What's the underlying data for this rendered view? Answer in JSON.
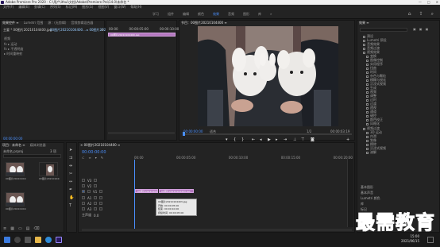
{
  "window": {
    "title": "Adobe Premiere Pro 2020 - C:\\用户\\ithui\\文档\\Adobe\\Premiere Pro\\14.0\\未命名 *",
    "controls": [
      "—",
      "□",
      "✕"
    ]
  },
  "menu": [
    "文件(F)",
    "编辑(E)",
    "剪辑(C)",
    "序列(S)",
    "标记(M)",
    "图形(G)",
    "视图(V)",
    "窗口(W)",
    "帮助(H)"
  ],
  "workspace": {
    "tabs": [
      "学习",
      "组件",
      "编辑",
      "颜色",
      "效果",
      "音频",
      "图形",
      "库"
    ],
    "active": "效果",
    "more": "»"
  },
  "source_panel": {
    "tabs": [
      "效果控件 ≡",
      "Lumetri 范围",
      "源：(无剪辑)",
      "音频剪辑混合器"
    ],
    "header": "主要 * 00图片20210104400.jpg",
    "seq_label": "00图片20210104400... ▸ 00图片20210104400.jpg",
    "rows": [
      "视频",
      "fx ▸ 运动",
      "fx ▸ 不透明度",
      "▸ 时间重映射"
    ],
    "timecode": "00:00:00:00"
  },
  "ec_timeline": {
    "ticks": [
      "00:00",
      "00:00:05:00",
      "00:00:10:00"
    ],
    "clip": "00图片20210104400.jpg"
  },
  "program": {
    "title": "节目：00图片20210104400 ≡",
    "timecode": "00:00:00:00",
    "fit": "适合",
    "ratio": "1/2",
    "duration": "00:00:03:19"
  },
  "project": {
    "tabs": [
      "项目：未命名 ≡",
      "媒体浏览器"
    ],
    "name": "未命名.prproj",
    "count": "3 项",
    "items": [
      "00图片20210104400.jpg",
      "00图片20210104403.jpg",
      "00图片20210104400"
    ]
  },
  "timeline": {
    "tab": "× 00图片20210104400 ≡",
    "timecode": "00:00:00:00",
    "ticks": [
      "00:00",
      "00:00:05:00",
      "00:00:10:00",
      "00:00:15:00",
      "00:00:20:00"
    ],
    "tracks": [
      "V3",
      "V2",
      "V1",
      "A1",
      "A2",
      "A3",
      "主声道"
    ],
    "master_val": "0.0",
    "clips": [
      "00图片20210104400.jpg",
      "00图片20210104403.jpg"
    ],
    "tooltip": [
      "00图片20210104403.jpg",
      "开始: 00:00:05:00",
      "结束: 00:00:10:00",
      "持续时间: 00:00:05:00"
    ]
  },
  "effects": {
    "tab": "效果 ≡",
    "items": [
      "预设",
      "Lumetri 预设",
      "音频效果",
      "音频过渡",
      "视频效果",
      "变换",
      "图像控制",
      "实用程序",
      "扭曲",
      "时间",
      "杂色与颗粒",
      "模糊与锐化",
      "沉浸式视频",
      "生成",
      "视频",
      "调整",
      "过时",
      "过渡",
      "透视",
      "通道",
      "键控",
      "颜色校正",
      "风格化",
      "视频过渡",
      "3D 运动",
      "内滑",
      "划像",
      "擦除",
      "沉浸式视频",
      "溶解"
    ],
    "bottom": [
      "基本图形",
      "基本声音",
      "Lumetri 颜色",
      "库",
      "标记"
    ]
  },
  "taskbar": {
    "time": "15:00",
    "date": "2021/06/15",
    "icons": [
      "windows-icon",
      "search-icon",
      "taskview-icon",
      "explorer-icon",
      "edge-icon",
      "premiere-icon"
    ]
  },
  "watermark": {
    "text": "最需教育",
    "color": "#1c4fd1"
  }
}
